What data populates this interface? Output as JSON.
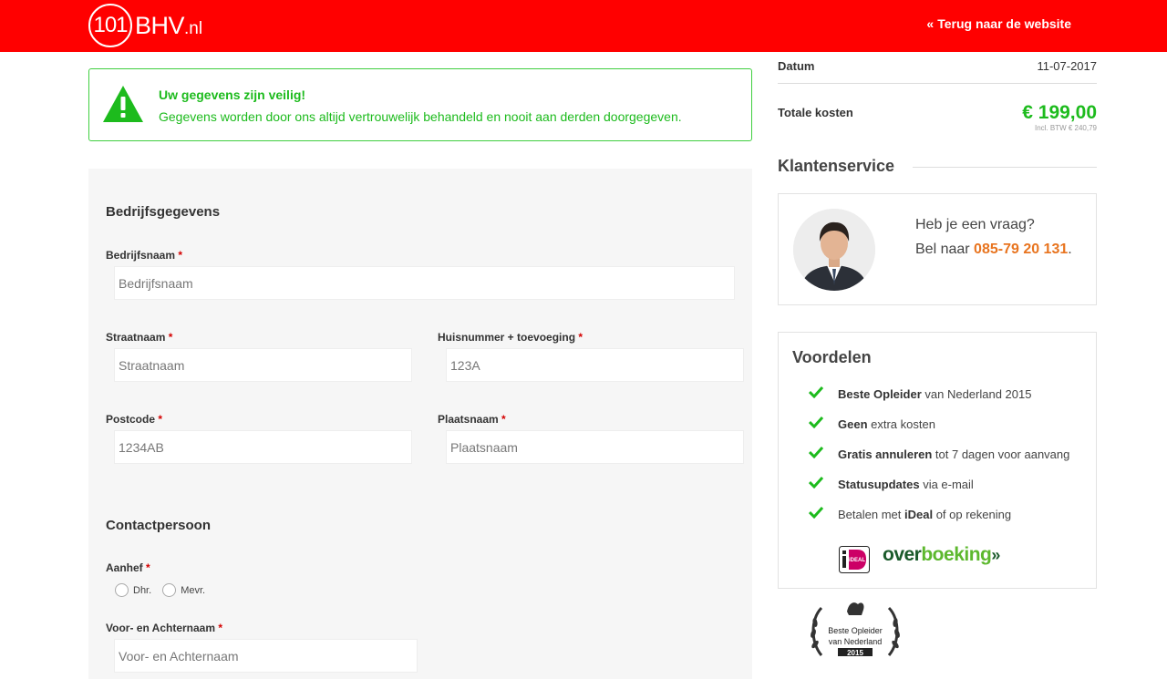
{
  "header": {
    "logo_number": "101",
    "logo_name": "BHV",
    "logo_ext": ".nl",
    "back_arrow": "«",
    "back_label": "Terug naar de website"
  },
  "notice": {
    "icon": "warning-triangle-icon",
    "title": "Uw gegevens zijn veilig!",
    "text": "Gegevens worden door ons altijd vertrouwelijk behandeld en nooit aan derden doorgegeven."
  },
  "form": {
    "company_section": "Bedrijfsgegevens",
    "contact_section": "Contactpersoon",
    "required_mark": "*",
    "fields": {
      "bedrijfsnaam": {
        "label": "Bedrijfsnaam",
        "placeholder": "Bedrijfsnaam"
      },
      "straatnaam": {
        "label": "Straatnaam",
        "placeholder": "Straatnaam"
      },
      "huisnummer": {
        "label": "Huisnummer + toevoeging",
        "placeholder": "123A"
      },
      "postcode": {
        "label": "Postcode",
        "placeholder": "1234AB"
      },
      "plaatsnaam": {
        "label": "Plaatsnaam",
        "placeholder": "Plaatsnaam"
      },
      "aanhef": {
        "label": "Aanhef",
        "options": [
          "Dhr.",
          "Mevr."
        ]
      },
      "naam": {
        "label": "Voor- en Achternaam",
        "placeholder": "Voor- en Achternaam"
      }
    }
  },
  "summary": {
    "date_label": "Datum",
    "date_value": "11-07-2017",
    "total_label": "Totale kosten",
    "total_price": "€ 199,00",
    "total_vat": "Incl. BTW € 240,79"
  },
  "service": {
    "title": "Klantenservice",
    "question": "Heb je een vraag?",
    "call_prefix": "Bel naar",
    "phone": "085-79 20 131",
    "call_suffix": "."
  },
  "benefits": {
    "title": "Voordelen",
    "items": [
      {
        "bold": "Beste Opleider",
        "text": " van Nederland 2015"
      },
      {
        "bold": "Geen",
        "text": " extra kosten"
      },
      {
        "bold": "Gratis annuleren",
        "text": " tot 7 dagen voor aanvang"
      },
      {
        "bold": "Statusupdates",
        "text": " via e-mail"
      },
      {
        "pre": "Betalen met ",
        "bold": "iDeal",
        "text": " of op rekening"
      }
    ],
    "ideal_label": "iDEAL",
    "overboeking_a": "over",
    "overboeking_b": "boeking",
    "overboeking_arrows": "»"
  },
  "badge": {
    "line1": "Beste Opleider",
    "line2": "van Nederland",
    "year": "2015"
  },
  "colors": {
    "brand_red": "#ff0000",
    "success_green": "#1dbb1d",
    "phone_orange": "#e8741f"
  }
}
